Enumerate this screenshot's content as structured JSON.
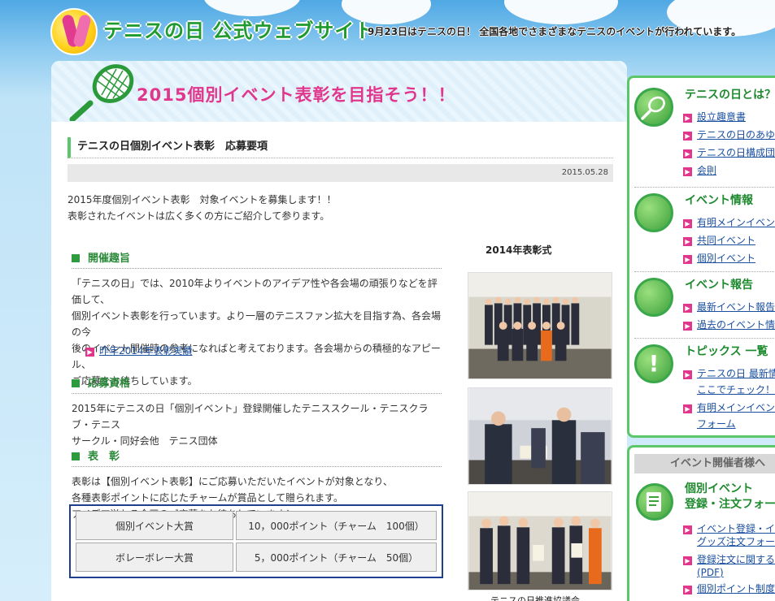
{
  "header": {
    "site_title": "テニスの日 公式ウェブサイト",
    "tagline": "9月23日はテニスの日！ 全国各地でさまざまなテニスのイベントが行われています。"
  },
  "banner": {
    "title": "2015個別イベント表彰を目指そう！！"
  },
  "article": {
    "title": "テニスの日個別イベント表彰　応募要項",
    "date": "2015.05.28",
    "intro_1": "2015年度個別イベント表彰　対象イベントを募集します！！",
    "intro_2": "表彰されたイベントは広く多くの方にご紹介して参ります。",
    "sections": [
      {
        "heading": "開催趣旨",
        "lines": [
          "「テニスの日」では、2010年よりイベントのアイデア性や各会場の頑張りなどを評価して、",
          "個別イベント表彰を行っています。より一層のテニスファン拡大を目指す為、各会場の今",
          "後のイベント開催時の参考になればと考えております。各会場からの積極的なアピール、",
          "ご応募をお待ちしています。"
        ],
        "link": "昨年2014年表彰実績"
      },
      {
        "heading": "応募資格",
        "lines": [
          "2015年にテニスの日「個別イベント」登録開催したテニススクール・テニスクラブ・テニス",
          "サークル・同好会他　テニス団体"
        ]
      },
      {
        "heading": "表　彰",
        "lines": [
          "表彰は【個別イベント表彰】にご応募いただいたイベントが対象となり、",
          "各種表彰ポイントに応じたチャームが賞品として贈られます。",
          "アイデア溢れる企画のご応募をお待ちしています！"
        ]
      }
    ],
    "awards": [
      {
        "name": "個別イベント大賞",
        "prize": "10，000ポイント（チャーム　100個）"
      },
      {
        "name": "ボレーボレー大賞",
        "prize": "5，000ポイント（チャーム　50個）"
      }
    ],
    "photo_caption_top": "2014年表彰式",
    "photo_caption_bottom": "テニスの日推進協議会"
  },
  "sidebar": {
    "groups": [
      {
        "heading": "テニスの日とは？",
        "icon": "racket-icon",
        "links": [
          "設立趣意書",
          "テニスの日のあゆみ",
          "テニスの日構成団体",
          "会則"
        ]
      },
      {
        "heading": "イベント情報",
        "icon": "tennis-ball-icon",
        "links": [
          "有明メインイベント",
          "共同イベント",
          "個別イベント"
        ]
      },
      {
        "heading": "イベント報告",
        "icon": "tennis-ball-icon",
        "links": [
          "最新イベント報告",
          "過去のイベント情報"
        ]
      },
      {
        "heading": "トピックス 一覧",
        "icon": "exclamation-icon",
        "links": [
          "テニスの日 最新情報",
          "ここでチェック！",
          "有明メインイベント参",
          "フォーム"
        ]
      }
    ],
    "organizer": {
      "heading": "イベント開催者様へ",
      "sub_1": "個別イベント",
      "sub_2": "登録・注文フォーム",
      "links": [
        "イベント登録・イベン",
        "グッズ注文フォーム",
        "登録注文に関するご",
        "(PDF)",
        "個別ポイント制度に"
      ]
    }
  },
  "colors": {
    "accent_green": "#2e9c3e",
    "accent_pink": "#e0378c",
    "link_blue": "#1a4fa0"
  }
}
